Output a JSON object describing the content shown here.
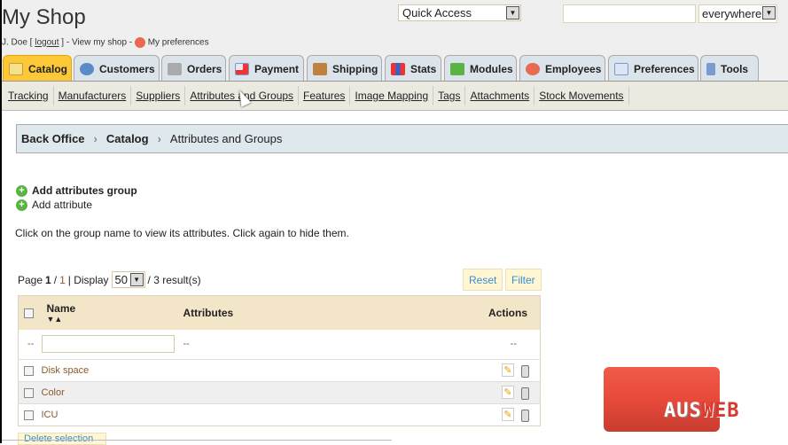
{
  "header": {
    "title": "My Shop",
    "user": "J. Doe [",
    "logout": "logout",
    "user_end": "] - View my shop -",
    "preferences": "My preferences",
    "quick_access": "Quick Access",
    "search_value": "",
    "search_scope": "everywhere"
  },
  "tabs": [
    {
      "label": "Catalog",
      "active": true,
      "icon": "folder-icon"
    },
    {
      "label": "Customers",
      "icon": "user-icon"
    },
    {
      "label": "Orders",
      "icon": "cart-icon"
    },
    {
      "label": "Payment",
      "icon": "payment-icon"
    },
    {
      "label": "Shipping",
      "icon": "truck-icon"
    },
    {
      "label": "Stats",
      "icon": "chart-icon"
    },
    {
      "label": "Modules",
      "icon": "puzzle-icon"
    },
    {
      "label": "Employees",
      "icon": "employee-icon"
    },
    {
      "label": "Preferences",
      "icon": "pencil-window-icon"
    },
    {
      "label": "Tools",
      "icon": "wrench-icon"
    }
  ],
  "subnav": [
    "Tracking",
    "Manufacturers",
    "Suppliers",
    "Attributes and Groups",
    "Features",
    "Image Mapping",
    "Tags",
    "Attachments",
    "Stock Movements"
  ],
  "breadcrumb": [
    "Back Office",
    "Catalog",
    "Attributes and Groups"
  ],
  "actions": {
    "add_group": "Add attributes group",
    "add_attribute": "Add attribute"
  },
  "hint": "Click on the group name to view its attributes. Click again to hide them.",
  "pager": {
    "page_label": "Page",
    "page": "1",
    "sep": "/",
    "total": "1",
    "display_label": "| Display",
    "per_page": "50",
    "results": "/ 3 result(s)"
  },
  "buttons": {
    "reset": "Reset",
    "filter": "Filter",
    "delete": "Delete selection"
  },
  "table": {
    "headers": {
      "name": "Name",
      "attributes": "Attributes",
      "actions": "Actions"
    },
    "filter_dash": "--",
    "rows": [
      {
        "name": "Disk space"
      },
      {
        "name": "Color"
      },
      {
        "name": "ICU"
      }
    ]
  },
  "logo": {
    "part1": "AUS",
    "part2": "WEB"
  },
  "colors": {
    "active_tab": "#fdc838",
    "tab": "#dbe4ea",
    "breadcrumb_bg": "#dfe8ec",
    "table_header": "#f3e6c8",
    "link_brown": "#8b5a2b",
    "button_text": "#3a8fd0"
  }
}
